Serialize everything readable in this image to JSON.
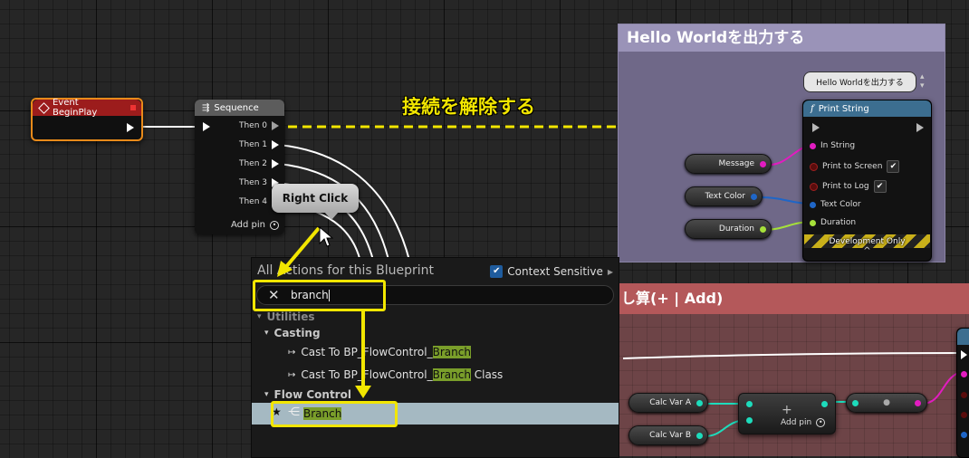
{
  "event_node": {
    "title": "Event BeginPlay"
  },
  "sequence_node": {
    "title": "Sequence",
    "pins": [
      "Then 0",
      "Then 1",
      "Then 2",
      "Then 3",
      "Then 4"
    ],
    "add_pin": "Add pin"
  },
  "annotation": {
    "disconnect": "接続を解除する",
    "right_click": "Right Click"
  },
  "comment_hello": {
    "title": "Hello Worldを出力する",
    "bubble": "Hello Worldを出力する"
  },
  "print_node": {
    "title": "Print String",
    "pins": [
      "In String",
      "Print to Screen",
      "Print to Log",
      "Text Color",
      "Duration"
    ],
    "footer": "Development Only"
  },
  "vars_top": [
    "Message",
    "Text Color",
    "Duration"
  ],
  "comment_add": {
    "title": "し算(+ | Add)"
  },
  "calc": {
    "var_a": "Calc Var A",
    "var_b": "Calc Var B",
    "add_pin": "Add pin",
    "plus": "+"
  },
  "menu": {
    "title": "All Actions for this Blueprint",
    "context_sensitive": "Context Sensitive",
    "search_value": "branch",
    "categories": {
      "utilities": "Utilities",
      "casting": "Casting",
      "flow_control": "Flow Control"
    },
    "items": [
      {
        "pre": "Cast To BP_FlowControl_",
        "hl": "Branch",
        "post": ""
      },
      {
        "pre": "Cast To BP_FlowControl_",
        "hl": "Branch",
        "post": " Class"
      }
    ],
    "selected": {
      "label": "Branch"
    }
  },
  "colors": {
    "event_header": "#9c1c1c",
    "comment_hello_title": "#9a93b8",
    "comment_hello_body": "#6f6888",
    "comment_add_title": "#b4585a",
    "comment_add_body": "#6d4447",
    "highlight": "#7a9e2a",
    "annotation_yellow": "#f2e600",
    "pin_pink": "#e21cc0",
    "pin_blue": "#1f66c7",
    "pin_green": "#a6e13a",
    "pin_teal": "#1ddcbc"
  }
}
